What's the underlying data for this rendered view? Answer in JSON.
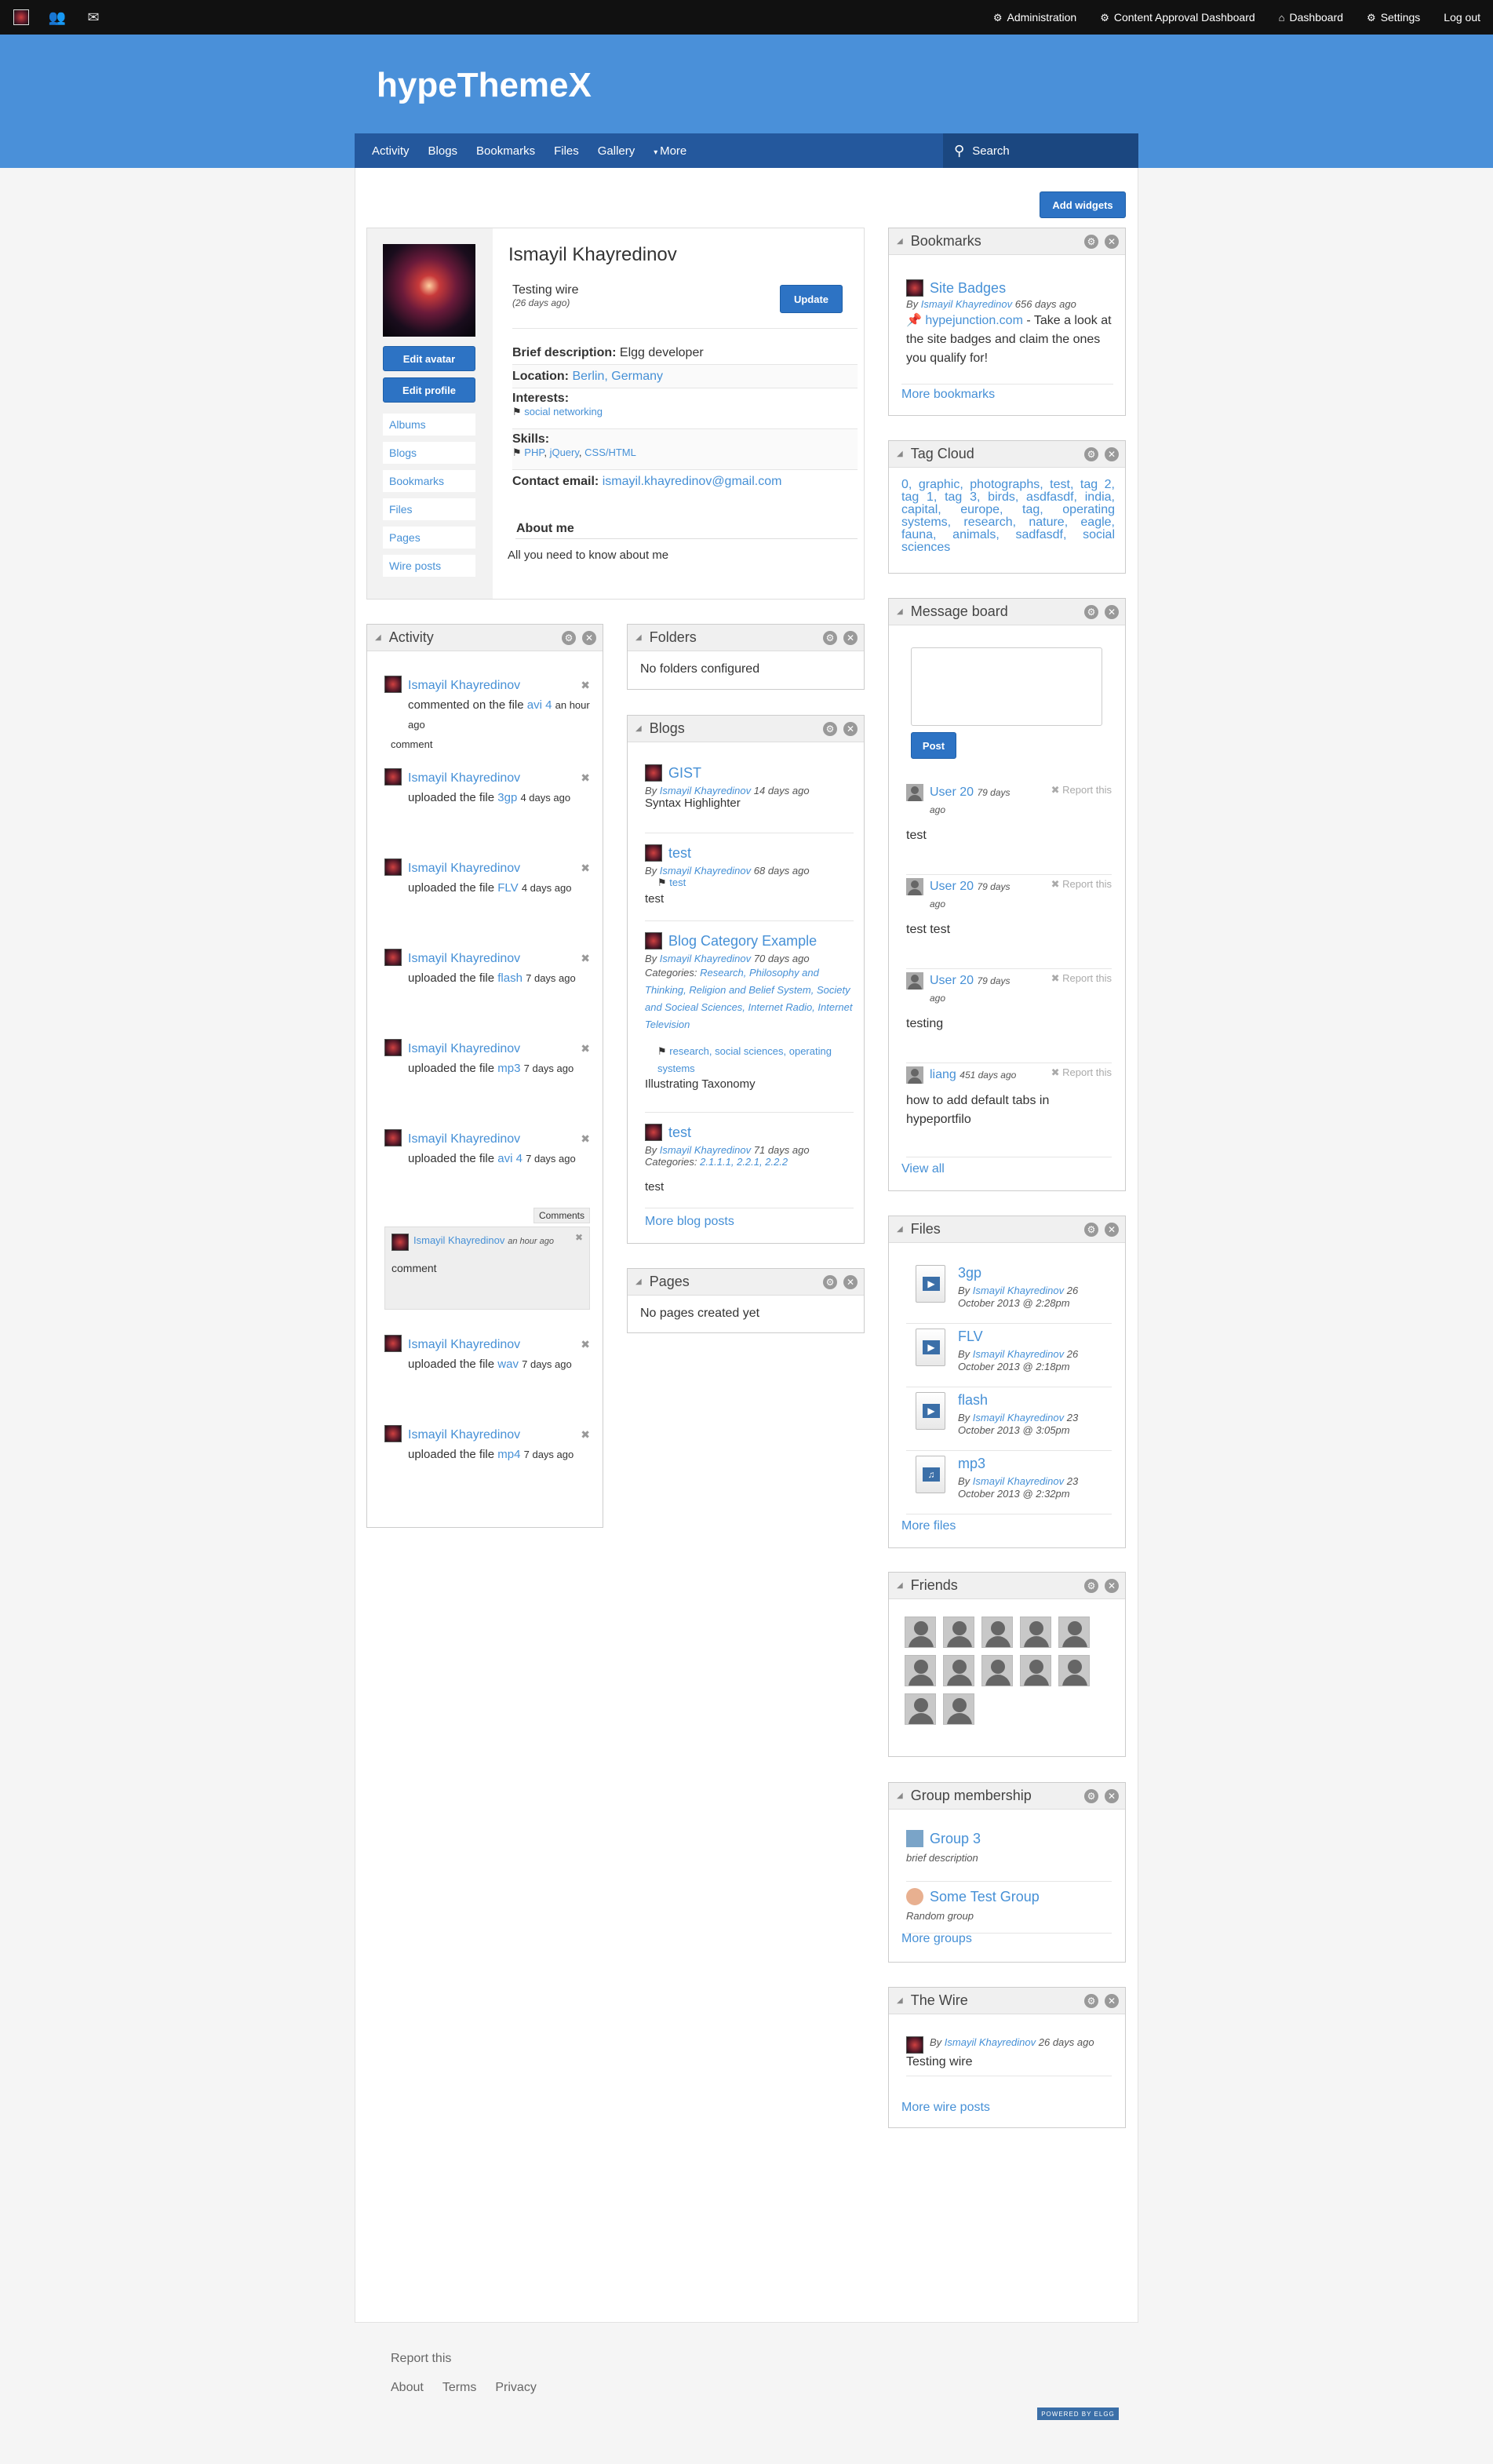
{
  "topbar": {
    "left_icons": [
      "elgg-logo-icon",
      "friends-icon",
      "mail-icon"
    ],
    "right": [
      {
        "icon": "gear-icon",
        "label": "Administration"
      },
      {
        "icon": "gear-icon",
        "label": "Content Approval Dashboard"
      },
      {
        "icon": "home-icon",
        "label": "Dashboard"
      },
      {
        "icon": "gear-icon",
        "label": "Settings"
      },
      {
        "icon": "",
        "label": "Log out"
      }
    ]
  },
  "site": {
    "title": "hypeThemeX"
  },
  "nav": {
    "items": [
      "Activity",
      "Blogs",
      "Bookmarks",
      "Files",
      "Gallery"
    ],
    "more": "More",
    "search_placeholder": "Search"
  },
  "add_widgets": "Add widgets",
  "profile": {
    "name": "Ismayil Khayredinov",
    "status": "Testing wire",
    "status_time": "(26 days ago)",
    "update": "Update",
    "edit_avatar": "Edit avatar",
    "edit_profile": "Edit profile",
    "menu": [
      "Albums",
      "Blogs",
      "Bookmarks",
      "Files",
      "Pages",
      "Wire posts"
    ],
    "brief_label": "Brief description:",
    "brief": "Elgg developer",
    "location_label": "Location:",
    "location": "Berlin, Germany",
    "interests_label": "Interests:",
    "interests": "social networking",
    "skills_label": "Skills:",
    "skills": [
      "PHP",
      "jQuery",
      "CSS/HTML"
    ],
    "email_label": "Contact email:",
    "email": "ismayil.khayredinov@gmail.com",
    "about_label": "About me",
    "about": "All you need to know about me"
  },
  "activity": {
    "title": "Activity",
    "items": [
      {
        "user": "Ismayil Khayredinov",
        "text": "commented on the file",
        "link": "avi 4",
        "time": "an hour ago",
        "extra": "comment"
      },
      {
        "user": "Ismayil Khayredinov",
        "text": "uploaded the file",
        "link": "3gp",
        "time": "4 days ago"
      },
      {
        "user": "Ismayil Khayredinov",
        "text": "uploaded the file",
        "link": "FLV",
        "time": "4 days ago"
      },
      {
        "user": "Ismayil Khayredinov",
        "text": "uploaded the file",
        "link": "flash",
        "time": "7 days ago"
      },
      {
        "user": "Ismayil Khayredinov",
        "text": "uploaded the file",
        "link": "mp3",
        "time": "7 days ago"
      },
      {
        "user": "Ismayil Khayredinov",
        "text": "uploaded the file",
        "link": "avi 4",
        "time": "7 days ago"
      },
      {
        "user": "Ismayil Khayredinov",
        "text": "uploaded the file",
        "link": "wav",
        "time": "7 days ago"
      },
      {
        "user": "Ismayil Khayredinov",
        "text": "uploaded the file",
        "link": "mp4",
        "time": "7 days ago"
      }
    ],
    "comments_tab": "Comments",
    "comment": {
      "user": "Ismayil Khayredinov",
      "time": "an hour ago",
      "text": "comment"
    }
  },
  "folders": {
    "title": "Folders",
    "empty": "No folders configured"
  },
  "blogs": {
    "title": "Blogs",
    "items": [
      {
        "title": "GIST",
        "by": "Ismayil Khayredinov",
        "time": "14 days ago",
        "excerpt": "Syntax Highlighter"
      },
      {
        "title": "test",
        "by": "Ismayil Khayredinov",
        "time": "68 days ago",
        "tags": "test",
        "excerpt": "test"
      },
      {
        "title": "Blog Category Example",
        "by": "Ismayil Khayredinov",
        "time": "70 days ago",
        "categories": "Research, Philosophy and Thinking, Religion and Belief System, Society and Socieal Sciences, Internet Radio, Internet Television",
        "tags": "research, social sciences, operating systems",
        "excerpt": "Illustrating Taxonomy"
      },
      {
        "title": "test",
        "by": "Ismayil Khayredinov",
        "time": "71 days ago",
        "categories": "2.1.1.1, 2.2.1, 2.2.2",
        "excerpt": "test"
      }
    ],
    "more": "More blog posts",
    "by_label": "By",
    "categories_label": "Categories:"
  },
  "pages": {
    "title": "Pages",
    "empty": "No pages created yet"
  },
  "bookmarks": {
    "title": "Bookmarks",
    "item": {
      "title": "Site Badges",
      "by": "Ismayil Khayredinov",
      "time": "656 days ago",
      "link": "hypejunction.com",
      "desc": "- Take a look at the site badges and claim the ones you qualify for!"
    },
    "more": "More bookmarks"
  },
  "tagcloud": {
    "title": "Tag Cloud",
    "tags": "0, graphic, photographs, test, tag 2, tag 1, tag 3, birds, asdfasdf, india, capital, europe, tag, operating systems, research, nature, eagle, fauna, animals, sadfasdf, social sciences"
  },
  "messageboard": {
    "title": "Message board",
    "post": "Post",
    "report": "Report this",
    "items": [
      {
        "user": "User 20",
        "time": "79 days ago",
        "text": "test"
      },
      {
        "user": "User 20",
        "time": "79 days ago",
        "text": "test test"
      },
      {
        "user": "User 20",
        "time": "79 days ago",
        "text": "testing"
      },
      {
        "user": "liang",
        "time": "451 days ago",
        "text": "how to add default tabs in hypeportfilo"
      }
    ],
    "view_all": "View all"
  },
  "files": {
    "title": "Files",
    "items": [
      {
        "name": "3gp",
        "by": "Ismayil Khayredinov",
        "date": "26 October 2013 @ 2:28pm"
      },
      {
        "name": "FLV",
        "by": "Ismayil Khayredinov",
        "date": "26 October 2013 @ 2:18pm"
      },
      {
        "name": "flash",
        "by": "Ismayil Khayredinov",
        "date": "23 October 2013 @ 3:05pm"
      },
      {
        "name": "mp3",
        "by": "Ismayil Khayredinov",
        "date": "23 October 2013 @ 2:32pm"
      }
    ],
    "more": "More files"
  },
  "friends": {
    "title": "Friends",
    "count": 12
  },
  "groups": {
    "title": "Group membership",
    "items": [
      {
        "name": "Group 3",
        "desc": "brief description"
      },
      {
        "name": "Some Test Group",
        "desc": "Random group"
      }
    ],
    "more": "More groups"
  },
  "wire": {
    "title": "The Wire",
    "by": "Ismayil Khayredinov",
    "time": "26 days ago",
    "text": "Testing wire",
    "more": "More wire posts"
  },
  "footer": {
    "report": "Report this",
    "links": [
      "About",
      "Terms",
      "Privacy"
    ],
    "badge": "POWERED BY ELGG"
  }
}
